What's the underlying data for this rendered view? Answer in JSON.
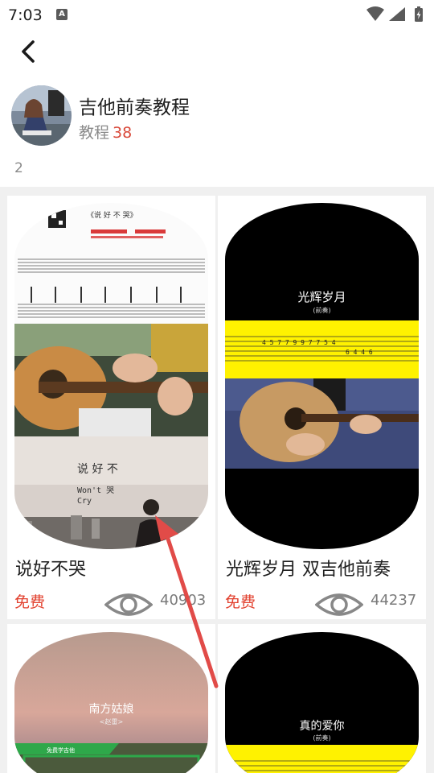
{
  "status_bar": {
    "time": "7:03",
    "notification_badge": "A"
  },
  "course": {
    "title": "吉他前奏教程",
    "meta_label": "教程",
    "meta_count": "38"
  },
  "section_number": "2",
  "cards": [
    {
      "title": "说好不哭",
      "price": "免费",
      "views": "40903",
      "thumb": {
        "sheet_title": "《说 好 不 哭》",
        "overlay_text": [
          "说 好 不",
          "Won't 哭",
          "Cry"
        ]
      }
    },
    {
      "title": "光辉岁月 双吉他前奏",
      "price": "免费",
      "views": "44237",
      "thumb": {
        "heading": "光辉岁月",
        "subheading": "(前奏)",
        "tab_numbers": "4 5 7 7 9 9 7 7 5 4",
        "tab_end": "6 4 4 6"
      }
    },
    {
      "thumb": {
        "heading": "南方姑娘",
        "subheading": "<赵雷>",
        "banner": "免费学吉他"
      }
    },
    {
      "thumb": {
        "heading": "真的爱你",
        "subheading": "(前奏)"
      }
    }
  ],
  "colors": {
    "accent_red": "#e2412f",
    "tab_yellow": "#fff200",
    "bg_grey": "#f0f0f0"
  }
}
